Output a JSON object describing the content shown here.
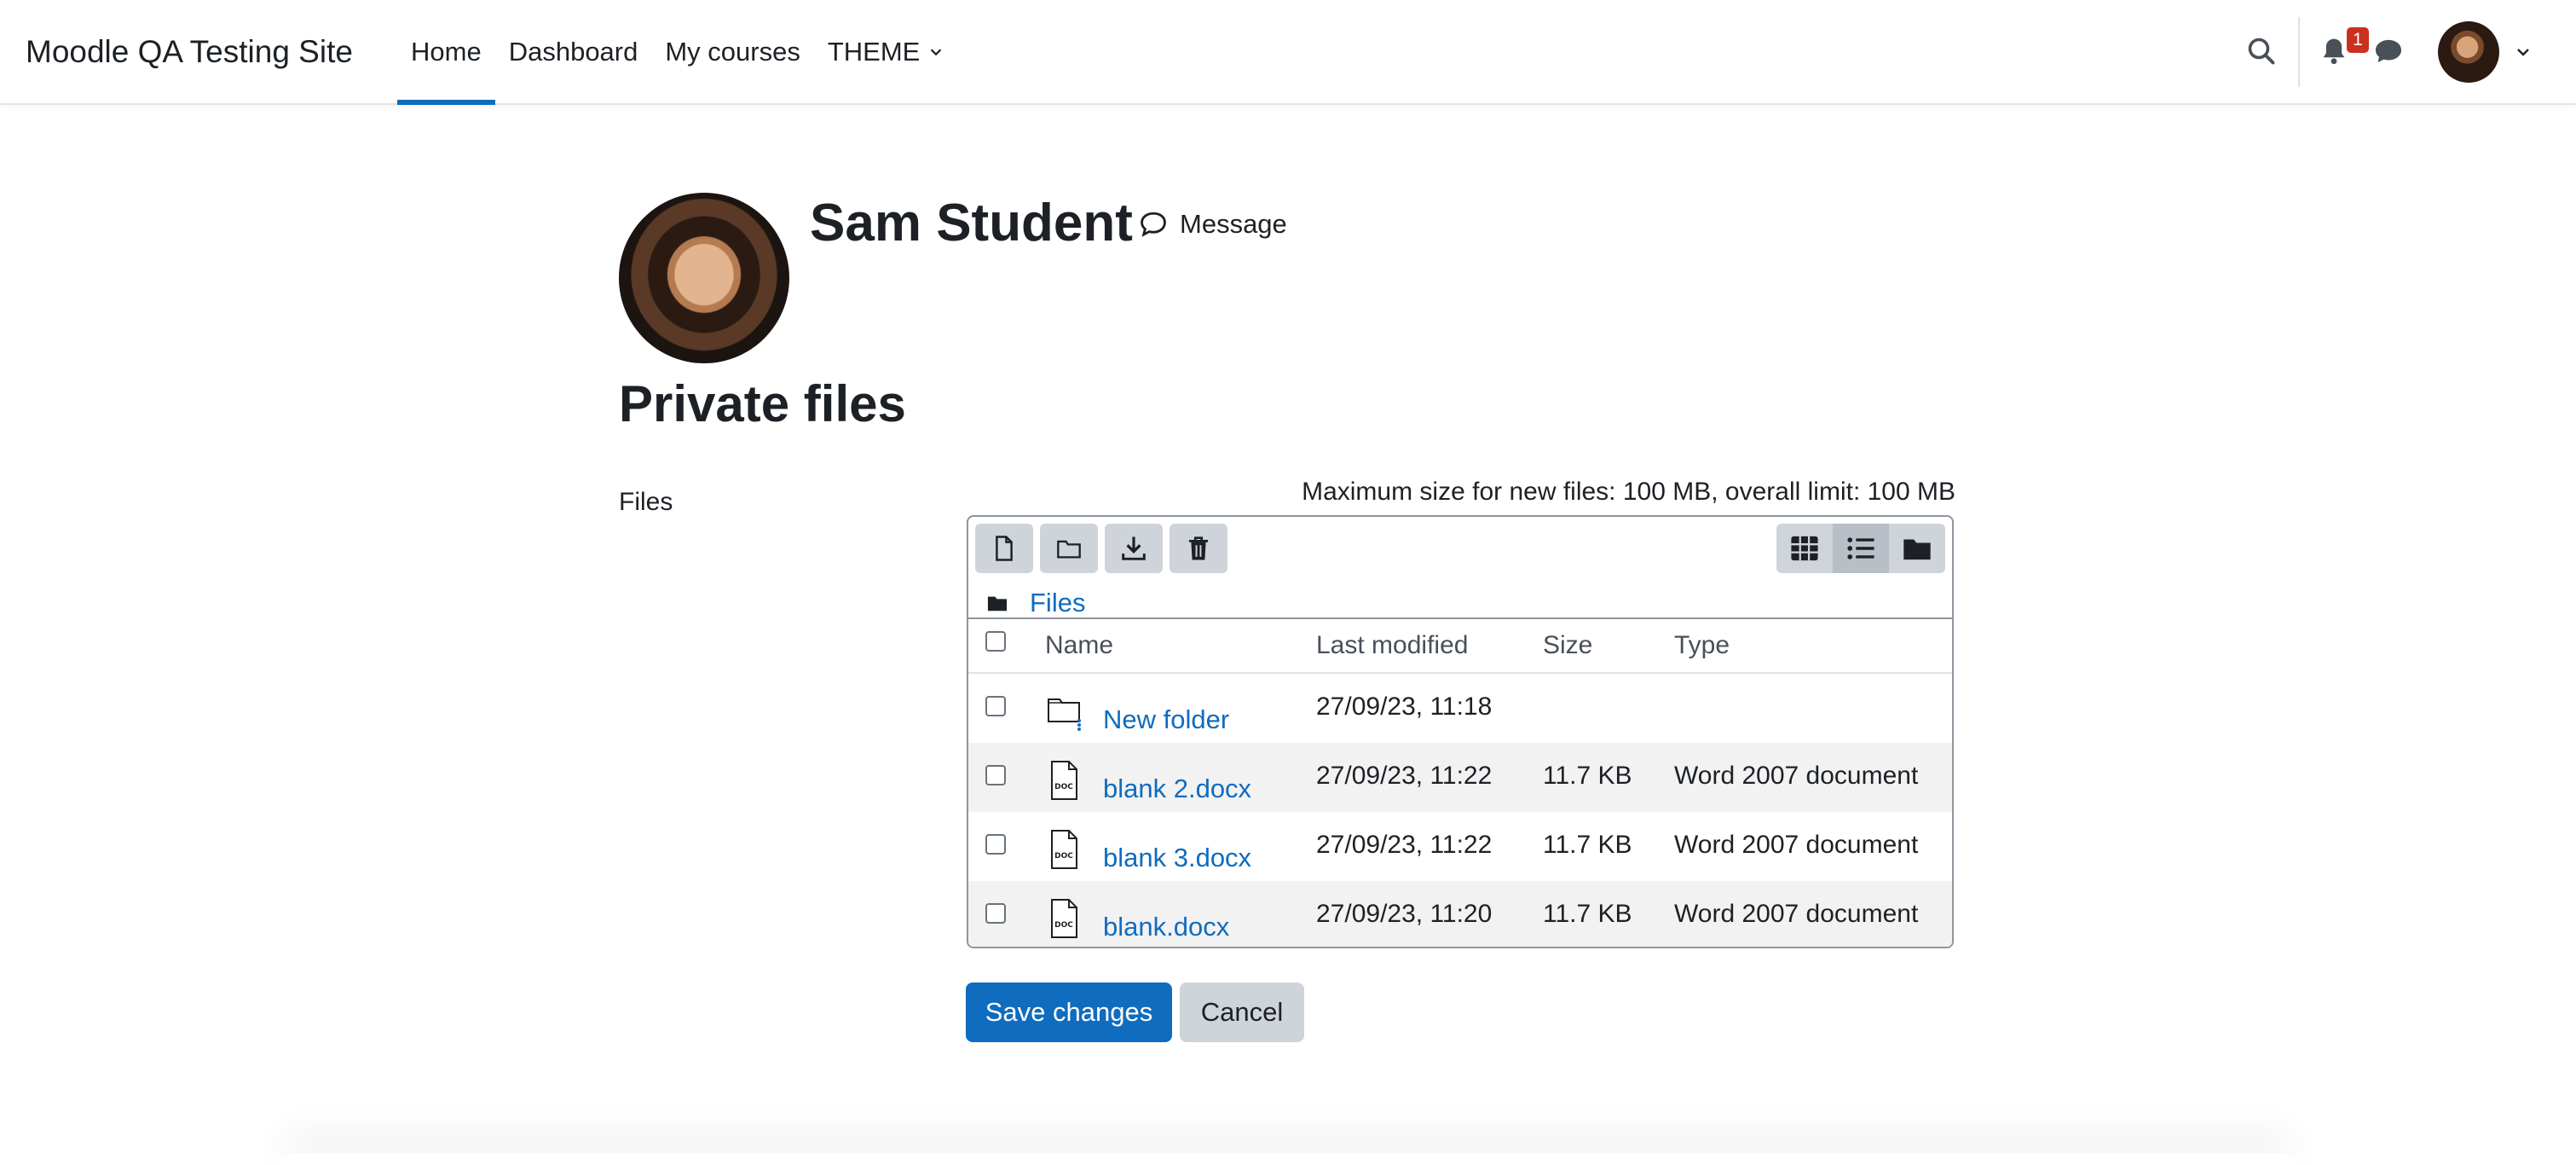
{
  "navbar": {
    "brand": "Moodle QA Testing Site",
    "items": [
      {
        "label": "Home",
        "active": true
      },
      {
        "label": "Dashboard",
        "active": false
      },
      {
        "label": "My courses",
        "active": false
      },
      {
        "label": "THEME",
        "active": false,
        "has_dropdown": true
      }
    ],
    "notification_count": "1",
    "icons": [
      "search-icon",
      "bell-icon",
      "chat-icon",
      "chevron-down-icon"
    ]
  },
  "profile": {
    "name": "Sam Student",
    "message_label": "Message"
  },
  "page": {
    "title": "Private files"
  },
  "form": {
    "files_label": "Files",
    "max_size_text": "Maximum size for new files: 100 MB, overall limit: 100 MB",
    "breadcrumb": "Files",
    "columns": {
      "name": "Name",
      "modified": "Last modified",
      "size": "Size",
      "type": "Type"
    },
    "rows": [
      {
        "name": "New folder",
        "modified": "27/09/23, 11:18",
        "size": "",
        "type": "",
        "kind": "folder"
      },
      {
        "name": "blank 2.docx",
        "modified": "27/09/23, 11:22",
        "size": "11.7 KB",
        "type": "Word 2007 document",
        "kind": "doc"
      },
      {
        "name": "blank 3.docx",
        "modified": "27/09/23, 11:22",
        "size": "11.7 KB",
        "type": "Word 2007 document",
        "kind": "doc"
      },
      {
        "name": "blank.docx",
        "modified": "27/09/23, 11:20",
        "size": "11.7 KB",
        "type": "Word 2007 document",
        "kind": "doc"
      }
    ],
    "doc_icon_text": "DOC",
    "save_label": "Save changes",
    "cancel_label": "Cancel"
  },
  "colors": {
    "primary": "#0f6cbf",
    "badge": "#ca3120",
    "toolbar_button": "#ced4da"
  }
}
